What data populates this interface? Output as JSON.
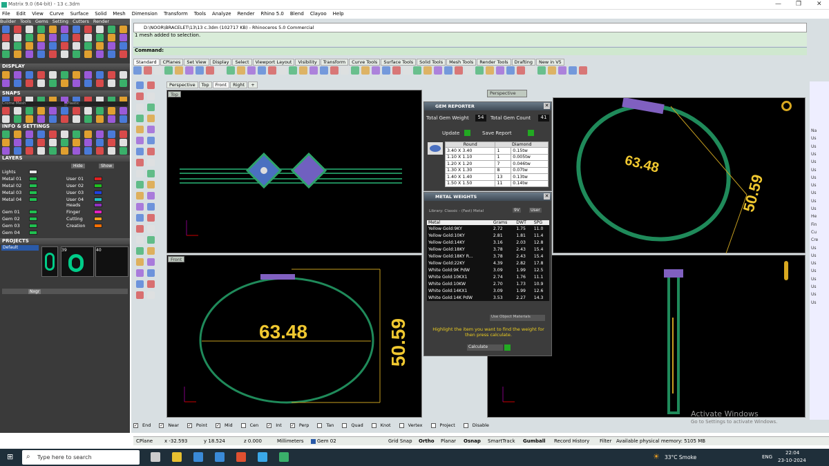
{
  "window": {
    "title": "Matrix 9.0 (64-bit) - 13 c.3dm",
    "min": "—",
    "max": "❐",
    "close": "✕"
  },
  "menu": [
    "File",
    "Edit",
    "View",
    "Curve",
    "Surface",
    "Solid",
    "Mesh",
    "Dimension",
    "Transform",
    "Tools",
    "Analyze",
    "Render",
    "Rhino 5.0",
    "Blend",
    "Clayoo",
    "Help"
  ],
  "left_menu": [
    "Builder",
    "Tools",
    "Gems",
    "Setting",
    "Cutters",
    "Render"
  ],
  "display": {
    "header": "DISPLAY",
    "mode1": "Crome Mesh",
    "mode2": "Plastic"
  },
  "snaps": {
    "header": "SNAPS",
    "values": [
      "0.1",
      "0.25",
      "1.0",
      "1.0"
    ]
  },
  "info": {
    "header": "INFO & SETTINGS"
  },
  "layers": {
    "header": "LAYERS",
    "hide": "Hide",
    "show": "Show",
    "left": [
      {
        "name": "Lights",
        "color": "#e8e8e8"
      },
      {
        "name": "Metal 01",
        "color": "#20c050"
      },
      {
        "name": "Metal 02",
        "color": "#20c050"
      },
      {
        "name": "Metal 03",
        "color": "#20c050"
      },
      {
        "name": "Metal 04",
        "color": "#20c050"
      },
      {
        "name": "Gem 01",
        "color": "#20c050"
      },
      {
        "name": "Gem 02",
        "color": "#20c050"
      },
      {
        "name": "Gem 03",
        "color": "#20c050"
      },
      {
        "name": "Gem 04",
        "color": "#20c050"
      }
    ],
    "right": [
      {
        "name": "User 01",
        "color": "#e02020"
      },
      {
        "name": "User 02",
        "color": "#20c020"
      },
      {
        "name": "User 03",
        "color": "#2040e0"
      },
      {
        "name": "User 04",
        "color": "#20c0c0"
      },
      {
        "name": "Heads",
        "color": "#9030c0"
      },
      {
        "name": "Finger",
        "color": "#e020c0"
      },
      {
        "name": "Cutting",
        "color": "#f0a020"
      },
      {
        "name": "Creation",
        "color": "#ff7000"
      }
    ]
  },
  "projects": {
    "header": "PROJECTS",
    "item": "Default",
    "nums": [
      "39",
      "40"
    ],
    "next": "Nxgr"
  },
  "rhino": {
    "file": "D:\\NOOR\\BRACELET\\13\\13 c.3dm (102717 KB) - Rhinoceros 5.0 Commercial",
    "history": "1 mesh added to selection.",
    "command_label": "Command:"
  },
  "tabs": [
    "Standard",
    "CPlanes",
    "Set View",
    "Display",
    "Select",
    "Viewport Layout",
    "Visibility",
    "Transform",
    "Curve Tools",
    "Surface Tools",
    "Solid Tools",
    "Mesh Tools",
    "Render Tools",
    "Drafting",
    "New in V5"
  ],
  "viewport_tabs": [
    "Perspective",
    "Top",
    "Front",
    "Right",
    "+"
  ],
  "viewports": {
    "top": "Top",
    "perspective": "Perspective",
    "front": "Front"
  },
  "dims": {
    "width": "63.48",
    "height": "50.59"
  },
  "gem_reporter": {
    "title": "GEM REPORTER",
    "weight_label": "Total Gem Weight",
    "weight": "54",
    "count_label": "Total Gem Count",
    "count": "41",
    "update": "Update",
    "save": "Save Report",
    "col1": "Round",
    "col2": "Diamond",
    "rows": [
      [
        "3.40 X 3.40",
        "1",
        "0.15tw"
      ],
      [
        "1.10 X 1.10",
        "1",
        "0.005tw"
      ],
      [
        "1.20 X 1.20",
        "7",
        "0.046tw"
      ],
      [
        "1.30 X 1.30",
        "8",
        "0.07tw"
      ],
      [
        "1.40 X 1.40",
        "13",
        "0.13tw"
      ],
      [
        "1.50 X 1.50",
        "11",
        "0.14tw"
      ]
    ]
  },
  "metal_weights": {
    "title": "METAL WEIGHTS",
    "library": "Library: Classic - (Fast) Metal",
    "opt1": "9V",
    "opt2": "User",
    "headers": [
      "Metal",
      "Grams",
      "DWT",
      "SPG"
    ],
    "rows": [
      [
        "Yellow Gold:9KY",
        "2.72",
        "1.75",
        "11.0"
      ],
      [
        "Yellow Gold:10KY",
        "2.81",
        "1.81",
        "11.4"
      ],
      [
        "Yellow Gold:14KY",
        "3.16",
        "2.03",
        "12.8"
      ],
      [
        "Yellow Gold:18KY",
        "3.78",
        "2.43",
        "15.4"
      ],
      [
        "Yellow Gold:18KY R...",
        "3.78",
        "2.43",
        "15.4"
      ],
      [
        "Yellow Gold:22KY",
        "4.39",
        "2.82",
        "17.8"
      ],
      [
        "White Gold:9K PdW",
        "3.09",
        "1.99",
        "12.5"
      ],
      [
        "White Gold:10KX1",
        "2.74",
        "1.76",
        "11.1"
      ],
      [
        "White Gold:10KW",
        "2.70",
        "1.73",
        "10.9"
      ],
      [
        "White Gold:14KX1",
        "3.09",
        "1.99",
        "12.6"
      ],
      [
        "White Gold:14K PdW",
        "3.53",
        "2.27",
        "14.3"
      ]
    ],
    "use_obj": "Use Object Materials",
    "hint": "Highlight the item you want to find the weight for then press calculate.",
    "calc": "Calculate"
  },
  "osnaps": [
    {
      "label": "End",
      "on": true
    },
    {
      "label": "Near",
      "on": true
    },
    {
      "label": "Point",
      "on": true
    },
    {
      "label": "Mid",
      "on": true
    },
    {
      "label": "Cen",
      "on": false
    },
    {
      "label": "Int",
      "on": true
    },
    {
      "label": "Perp",
      "on": true
    },
    {
      "label": "Tan",
      "on": false
    },
    {
      "label": "Quad",
      "on": false
    },
    {
      "label": "Knot",
      "on": false
    },
    {
      "label": "Vertex",
      "on": false
    },
    {
      "label": "Project",
      "on": false
    },
    {
      "label": "Disable",
      "on": false
    }
  ],
  "status": {
    "cplane": "CPlane",
    "x": "x -32.593",
    "y": "y 18.524",
    "z": "z 0.000",
    "units": "Millimeters",
    "layer": "Gem 02",
    "grid": "Grid Snap",
    "ortho": "Ortho",
    "planar": "Planar",
    "osnap": "Osnap",
    "smart": "SmartTrack",
    "gumball": "Gumball",
    "history": "Record History",
    "filter": "Filter",
    "memory": "Available physical memory: 5105 MB"
  },
  "watermark": {
    "line1": "Activate Windows",
    "line2": "Go to Settings to activate Windows."
  },
  "taskbar": {
    "search": "Type here to search",
    "weather": "33°C  Smoke",
    "lang": "ENG",
    "time": "22:04",
    "date": "23-10-2024"
  },
  "right_strip": [
    "Na",
    "Us",
    "Us",
    "Us",
    "Us",
    "Us",
    "Us",
    "Us",
    "Us",
    "Us",
    "Us",
    "He",
    "Fin",
    "Cu",
    "Cre",
    "Us",
    "Us",
    "Us",
    "Us",
    "Us",
    "Us",
    "Us",
    "Us"
  ]
}
